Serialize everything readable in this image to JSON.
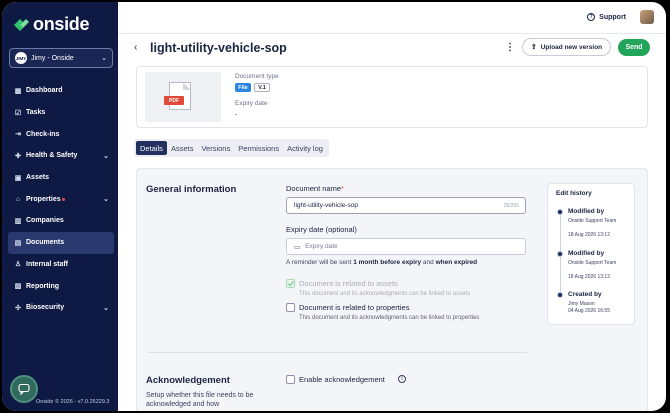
{
  "brand": {
    "name": "onside",
    "accent": "#22a45a",
    "sidebar_bg": "#0e1a44"
  },
  "org": {
    "avatar_text": "JIMY",
    "name": "Jimy - Onside"
  },
  "nav": [
    {
      "label": "Dashboard",
      "icon": "dashboard-icon",
      "glyph": "▦",
      "chevron": false
    },
    {
      "label": "Tasks",
      "icon": "tasks-icon",
      "glyph": "☑",
      "chevron": false
    },
    {
      "label": "Check-ins",
      "icon": "check-in-icon",
      "glyph": "⇥",
      "chevron": false
    },
    {
      "label": "Health & Safety",
      "icon": "shield-plus-icon",
      "glyph": "✚",
      "chevron": true
    },
    {
      "label": "Assets",
      "icon": "assets-icon",
      "glyph": "▣",
      "chevron": false
    },
    {
      "label": "Properties",
      "icon": "property-icon",
      "glyph": "⌂",
      "chevron": true,
      "dot": true
    },
    {
      "label": "Companies",
      "icon": "building-icon",
      "glyph": "▥",
      "chevron": false
    },
    {
      "label": "Documents",
      "icon": "document-icon",
      "glyph": "▤",
      "chevron": false,
      "active": true
    },
    {
      "label": "Internal staff",
      "icon": "person-icon",
      "glyph": "♙",
      "chevron": false
    },
    {
      "label": "Reporting",
      "icon": "chart-icon",
      "glyph": "▨",
      "chevron": false
    },
    {
      "label": "Biosecurity",
      "icon": "biosecurity-icon",
      "glyph": "✣",
      "chevron": true
    }
  ],
  "footer": {
    "version": "Onside © 2026 - v7.0.26229.3"
  },
  "topbar": {
    "support": "Support"
  },
  "header": {
    "title": "light-utility-vehicle-sop",
    "upload_label": "Upload new version",
    "send_label": "Send"
  },
  "doc": {
    "thumb_badge": "PDF",
    "type_label": "Document type",
    "type_chip": "File",
    "version_chip": "V.1",
    "expiry_label": "Expiry date",
    "expiry_value": "-"
  },
  "tabs": [
    {
      "label": "Details",
      "active": true
    },
    {
      "label": "Assets"
    },
    {
      "label": "Versions"
    },
    {
      "label": "Permissions"
    },
    {
      "label": "Activity log"
    }
  ],
  "general": {
    "title": "General information",
    "name_label": "Document name",
    "required_mark": "*",
    "name_value": "light-utility-vehicle-sop",
    "name_counter": "25/255",
    "expiry_label": "Expiry date (optional)",
    "expiry_placeholder": "Expiry date",
    "reminder_prefix": "A reminder will be sent ",
    "reminder_bold1": "1 month before expiry",
    "reminder_mid": " and ",
    "reminder_bold2": "when expired",
    "assets_check_label": "Document is related to assets",
    "assets_check_sub": "This document and its acknowledgments can be linked to assets",
    "assets_checked": true,
    "props_check_label": "Document is related to properties",
    "props_check_sub": "This document and its acknowledgments can be linked to properties",
    "props_checked": false
  },
  "history": {
    "title": "Edit history",
    "entries": [
      {
        "head": "Modified by",
        "who": "Onside Support Team",
        "when": "18 Aug 2026 13:12"
      },
      {
        "head": "Modified by",
        "who": "Onside Support Team",
        "when": "18 Aug 2026 13:12"
      },
      {
        "head": "Created by",
        "who": "Jimy Mason",
        "when": "04 Aug 2026 16:55"
      }
    ]
  },
  "ack": {
    "title": "Acknowledgement",
    "desc": "Setup whether this file needs to be acknowledged and how",
    "check_label": "Enable acknowledgement",
    "info_glyph": "i"
  }
}
